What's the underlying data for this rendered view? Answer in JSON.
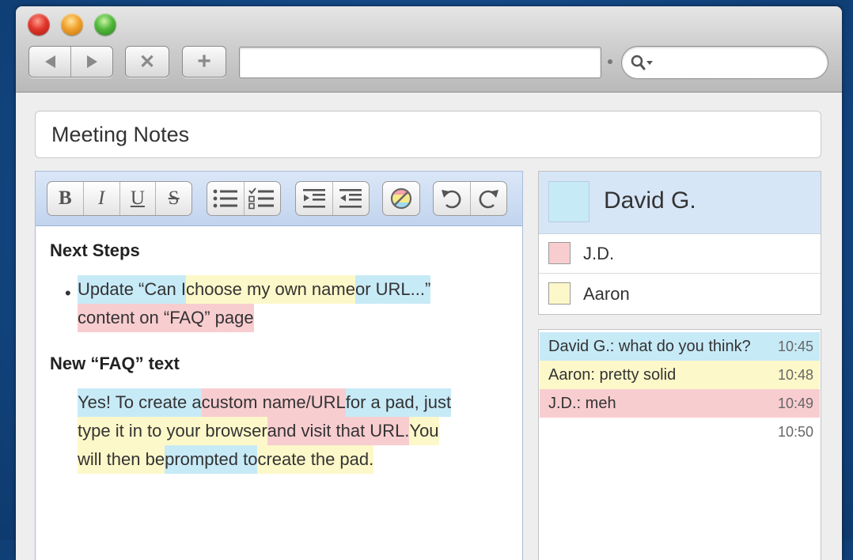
{
  "page": {
    "title": "Meeting Notes"
  },
  "browser": {
    "url_value": "",
    "search_value": ""
  },
  "toolbar": {
    "bold": "B",
    "italic": "I",
    "underline": "U",
    "strike": "S"
  },
  "doc": {
    "heading1": "Next Steps",
    "bullet": "•",
    "item_line1": [
      {
        "text": "Update “Can I ",
        "color": "blue"
      },
      {
        "text": "choose my own name ",
        "color": "yellow"
      },
      {
        "text": "or URL...”",
        "color": "blue"
      }
    ],
    "item_line2": [
      {
        "text": "content on “FAQ” page",
        "color": "pink"
      }
    ],
    "heading2": "New “FAQ” text",
    "para_line1": [
      {
        "text": "Yes! To create a ",
        "color": "blue"
      },
      {
        "text": "custom name/URL ",
        "color": "pink"
      },
      {
        "text": "for a pad, just",
        "color": "blue"
      }
    ],
    "para_line2": [
      {
        "text": "type it in to your browser ",
        "color": "yellow"
      },
      {
        "text": "and visit that URL. ",
        "color": "pink"
      },
      {
        "text": "You",
        "color": "yellow"
      }
    ],
    "para_line3": [
      {
        "text": "will then be ",
        "color": "yellow"
      },
      {
        "text": "prompted to ",
        "color": "blue"
      },
      {
        "text": "create the pad.",
        "color": "yellow"
      }
    ]
  },
  "users": {
    "me": {
      "name": "David G.",
      "color": "#c7eaf7"
    },
    "others": [
      {
        "name": "J.D.",
        "color": "#f8cdd0"
      },
      {
        "name": "Aaron",
        "color": "#fdf8c9"
      }
    ]
  },
  "chat": {
    "messages": [
      {
        "text": "David G.: what do you think?",
        "time": "10:45",
        "color": "#c7eaf7"
      },
      {
        "text": "Aaron: pretty solid",
        "time": "10:48",
        "color": "#fdf8c9"
      },
      {
        "text": "J.D.: meh",
        "time": "10:49",
        "color": "#f8cdd0"
      },
      {
        "text": "",
        "time": "10:50",
        "color": "#ffffff"
      }
    ]
  },
  "colors": {
    "blue": "#c7eaf7",
    "yellow": "#fdf8c9",
    "pink": "#f8cdd0",
    "toolbar_bg": "#c1d4ee",
    "desktop": "#134783"
  }
}
